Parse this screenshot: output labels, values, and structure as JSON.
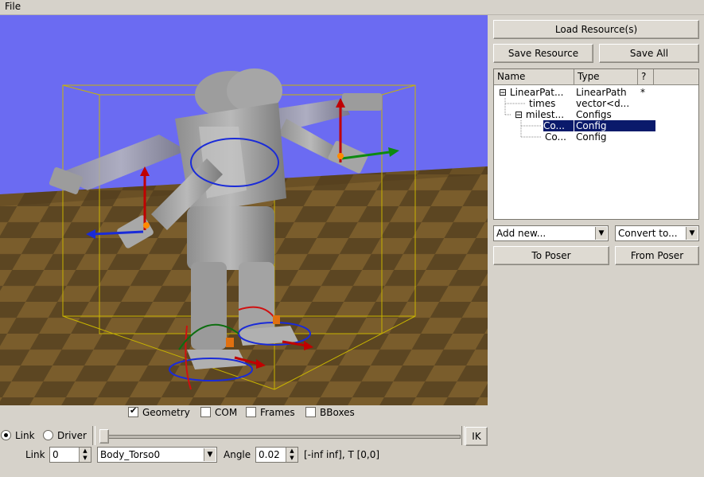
{
  "menu": {
    "file": "File"
  },
  "right_panel": {
    "load_resources": "Load Resource(s)",
    "save_resource": "Save Resource",
    "save_all": "Save All",
    "tree_headers": [
      "Name",
      "Type",
      "?"
    ],
    "tree_rows": [
      {
        "toggle": "⊟",
        "name": "LinearPat...",
        "type": "LinearPath",
        "flag": "*"
      },
      {
        "toggle": "",
        "name": "times",
        "type": "vector<d...",
        "flag": ""
      },
      {
        "toggle": "⊟",
        "name": "milest...",
        "type": "Configs",
        "flag": ""
      },
      {
        "toggle": "",
        "name": "Co...",
        "type": "Config",
        "flag": "",
        "selected": true
      },
      {
        "toggle": "",
        "name": "Co...",
        "type": "Config",
        "flag": ""
      }
    ],
    "add_new": "Add new...",
    "convert_to": "Convert to...",
    "to_poser": "To Poser",
    "from_poser": "From Poser"
  },
  "view_options": {
    "geometry": {
      "label": "Geometry",
      "checked": true
    },
    "com": {
      "label": "COM",
      "checked": false
    },
    "frames": {
      "label": "Frames",
      "checked": false
    },
    "bboxes": {
      "label": "BBoxes",
      "checked": false
    }
  },
  "controls": {
    "mode_link": "Link",
    "mode_driver": "Driver",
    "ik": "IK",
    "link_label": "Link",
    "link_index": "0",
    "link_name": "Body_Torso0",
    "angle_label": "Angle",
    "angle_value": "0.02",
    "limits": "[-inf inf], T [0,0]"
  },
  "colors": {
    "sky": "#6b6bf2",
    "floor_dark": "#5a4520",
    "floor_light": "#7a5e2c",
    "selection": "#0a1a6b"
  }
}
